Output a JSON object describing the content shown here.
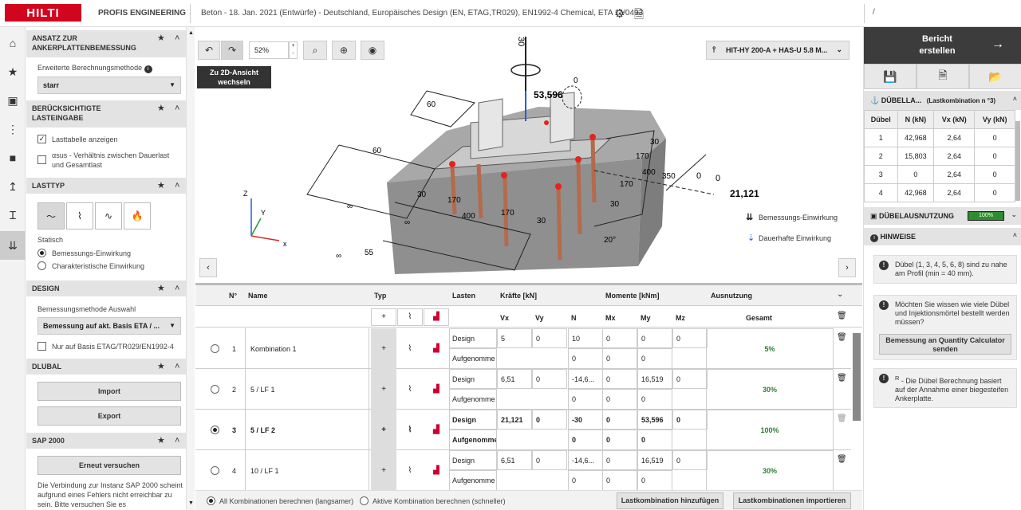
{
  "top": {
    "logo": "HILTI",
    "product": "PROFIS ENGINEERING",
    "project": "Beton - 18. Jan. 2021 (Entwürfe) - Deutschland, Europäisches Design (EN, ETAG,TR029), EN1992-4 Chemical, ETA 11/0493",
    "path": "/"
  },
  "left": {
    "sec1_title": "ANSATZ ZUR ANKERPLATTENBEMESSUNG",
    "method_label": "Erweiterte Berechnungsmethode",
    "method_value": "starr",
    "sec2_title": "BERÜCKSICHTIGTE LASTEINGABE",
    "chk_lasttabelle": "Lasttabelle anzeigen",
    "chk_asus": "αsus - Verhältnis zwischen Dauerlast und Gesamtlast",
    "sec3_title": "LASTTYP",
    "statisch": "Statisch",
    "radio_bemessung": "Bemessungs-Einwirkung",
    "radio_char": "Charakteristische Einwirkung",
    "sec4_title": "DESIGN",
    "design_label": "Bemessungsmethode Auswahl",
    "design_value": "Bemessung auf akt. Basis ETA / ...",
    "chk_etag": "Nur auf Basis ETAG/TR029/EN1992-4",
    "sec5_title": "DLUBAL",
    "import": "Import",
    "export": "Export",
    "sec6_title": "SAP 2000",
    "retry": "Erneut versuchen",
    "sap_msg": "Die Verbindung zur Instanz SAP 2000 scheint aufgrund eines Fehlers nicht erreichbar zu sein. Bitte versuchen Sie es"
  },
  "viewer": {
    "zoom": "52%",
    "switch_2d": "Zu 2D-Ansicht wechseln",
    "product_select": "HIT-HY 200-A + HAS-U 5.8 M...",
    "legend_design": "Bemessungs-Einwirkung",
    "legend_permanent": "Dauerhafte Einwirkung",
    "dims": {
      "d30": "30",
      "d53": "53,596",
      "d0a": "0",
      "d0b": "0",
      "d0c": "0",
      "d21": "21,121",
      "d60a": "60",
      "d60b": "60",
      "d30a": "30",
      "d170a": "170",
      "d400a": "400",
      "d170b": "170",
      "d30b": "30",
      "d30c": "30",
      "d170c": "170",
      "d400b": "400",
      "d170d": "170",
      "d30d": "30",
      "d350": "350",
      "d20": "20°",
      "dinf1": "∞",
      "dinf2": "∞",
      "dinf3": "∞",
      "d55": "55",
      "ax_x": "x",
      "ax_y": "Y",
      "ax_z": "Z"
    }
  },
  "loads": {
    "headers": {
      "no": "N°",
      "name": "Name",
      "typ": "Typ",
      "lasten": "Lasten",
      "kraefte": "Kräfte [kN]",
      "momente": "Momente [kNm]",
      "ausnutzung": "Ausnutzung"
    },
    "subheaders": {
      "vx": "Vx",
      "vy": "Vy",
      "n": "N",
      "mx": "Mx",
      "my": "My",
      "mz": "Mz",
      "gesamt": "Gesamt"
    },
    "rows": [
      {
        "no": "1",
        "name": "Kombination 1",
        "r1": "Design",
        "r2": "Aufgenomme",
        "vx": "5",
        "vy": "0",
        "n": "10",
        "mx": "0",
        "my": "0",
        "mz": "0",
        "n2": "0",
        "mx2": "0",
        "my2": "0",
        "ges": "5%"
      },
      {
        "no": "2",
        "name": "5 / LF 1",
        "r1": "Design",
        "r2": "Aufgenomme",
        "vx": "6,51",
        "vy": "0",
        "n": "-14,6...",
        "mx": "0",
        "my": "16,519",
        "mz": "0",
        "n2": "0",
        "mx2": "0",
        "my2": "0",
        "ges": "30%"
      },
      {
        "no": "3",
        "name": "5 / LF 2",
        "r1": "Design",
        "r2": "Aufgenomme",
        "vx": "21,121",
        "vy": "0",
        "n": "-30",
        "mx": "0",
        "my": "53,596",
        "mz": "0",
        "n2": "0",
        "mx2": "0",
        "my2": "0",
        "ges": "100%"
      },
      {
        "no": "4",
        "name": "10 / LF 1",
        "r1": "Design",
        "r2": "Aufgenomme",
        "vx": "6,51",
        "vy": "0",
        "n": "-14,6...",
        "mx": "0",
        "my": "16,519",
        "mz": "0",
        "n2": "0",
        "mx2": "0",
        "my2": "0",
        "ges": "30%"
      }
    ],
    "radio_all": "All Kombinationen berechnen (langsamer)",
    "radio_active": "Aktive Kombination berechnen (schneller)",
    "btn_add": "Lastkombination hinzufügen",
    "btn_import": "Lastkombinationen importieren"
  },
  "right": {
    "bericht": "Bericht erstellen",
    "duebel_title": "DÜBELLA...",
    "duebel_sub": "(Lastkombination n °3)",
    "cols": [
      "Dübel",
      "N (kN)",
      "Vx (kN)",
      "Vy (kN)"
    ],
    "rows": [
      [
        "1",
        "42,968",
        "2,64",
        "0"
      ],
      [
        "2",
        "15,803",
        "2,64",
        "0"
      ],
      [
        "3",
        "0",
        "2,64",
        "0"
      ],
      [
        "4",
        "42,968",
        "2,64",
        "0"
      ]
    ],
    "ausnutzung_title": "DÜBELAUSNUTZUNG",
    "ausnutzung_badge": "100%",
    "hinweise": "HINWEISE",
    "note1": "Dübel (1, 3, 4, 5, 6, 8) sind zu nahe am Profil (min = 40 mm).",
    "note2": "Möchten Sie wissen wie viele Dübel und Injektionsmörtel bestellt werden müssen?",
    "note2_btn": "Bemessung an Quantity Calculator senden",
    "note3_sup": "R",
    "note3": " - Die Dübel Berechnung basiert auf der Annahme einer biegesteifen Ankerplatte."
  },
  "colors": {
    "brand": "#d2051e",
    "ok_green": "#2e7d32",
    "dark": "#3c3c3c",
    "badge": "#2e8b2e"
  }
}
